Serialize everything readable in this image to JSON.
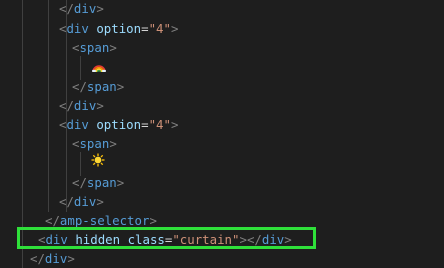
{
  "lines": [
    [
      {
        "c": "tk-b",
        "t": "</"
      },
      {
        "c": "tk-t",
        "t": "div"
      },
      {
        "c": "tk-b",
        "t": ">"
      }
    ],
    [
      {
        "c": "tk-b",
        "t": "<"
      },
      {
        "c": "tk-t",
        "t": "div"
      },
      {
        "c": "tk-o",
        "t": " "
      },
      {
        "c": "tk-a",
        "t": "option"
      },
      {
        "c": "tk-o",
        "t": "="
      },
      {
        "c": "tk-s",
        "t": "\"4\""
      },
      {
        "c": "tk-b",
        "t": ">"
      }
    ],
    [
      {
        "c": "tk-b",
        "t": "<"
      },
      {
        "c": "tk-t",
        "t": "span"
      },
      {
        "c": "tk-b",
        "t": ">"
      }
    ],
    [],
    [
      {
        "c": "tk-b",
        "t": "</"
      },
      {
        "c": "tk-t",
        "t": "span"
      },
      {
        "c": "tk-b",
        "t": ">"
      }
    ],
    [
      {
        "c": "tk-b",
        "t": "</"
      },
      {
        "c": "tk-t",
        "t": "div"
      },
      {
        "c": "tk-b",
        "t": ">"
      }
    ],
    [
      {
        "c": "tk-b",
        "t": "<"
      },
      {
        "c": "tk-t",
        "t": "div"
      },
      {
        "c": "tk-o",
        "t": " "
      },
      {
        "c": "tk-a",
        "t": "option"
      },
      {
        "c": "tk-o",
        "t": "="
      },
      {
        "c": "tk-s",
        "t": "\"4\""
      },
      {
        "c": "tk-b",
        "t": ">"
      }
    ],
    [
      {
        "c": "tk-b",
        "t": "<"
      },
      {
        "c": "tk-t",
        "t": "span"
      },
      {
        "c": "tk-b",
        "t": ">"
      }
    ],
    [],
    [
      {
        "c": "tk-b",
        "t": "</"
      },
      {
        "c": "tk-t",
        "t": "span"
      },
      {
        "c": "tk-b",
        "t": ">"
      }
    ],
    [
      {
        "c": "tk-b",
        "t": "</"
      },
      {
        "c": "tk-t",
        "t": "div"
      },
      {
        "c": "tk-b",
        "t": ">"
      }
    ],
    [
      {
        "c": "tk-b",
        "t": "</"
      },
      {
        "c": "tk-t",
        "t": "amp-selector"
      },
      {
        "c": "tk-b",
        "t": ">"
      }
    ],
    [
      {
        "c": "tk-b",
        "t": "<"
      },
      {
        "c": "tk-t",
        "t": "div"
      },
      {
        "c": "tk-o",
        "t": " "
      },
      {
        "c": "tk-a",
        "t": "hidden"
      },
      {
        "c": "tk-o",
        "t": " "
      },
      {
        "c": "tk-a",
        "t": "class"
      },
      {
        "c": "tk-o",
        "t": "="
      },
      {
        "c": "tk-s",
        "t": "\"curtain\""
      },
      {
        "c": "tk-b",
        "t": "></"
      },
      {
        "c": "tk-t",
        "t": "div"
      },
      {
        "c": "tk-b",
        "t": ">"
      }
    ],
    [
      {
        "c": "tk-b",
        "t": "</"
      },
      {
        "c": "tk-t",
        "t": "div"
      },
      {
        "c": "tk-b",
        "t": ">"
      }
    ]
  ],
  "emojis": {
    "rainbow": "rainbow-emoji-icon",
    "sun": "sun-emoji-icon"
  },
  "highlight_color": "#2fe03a"
}
